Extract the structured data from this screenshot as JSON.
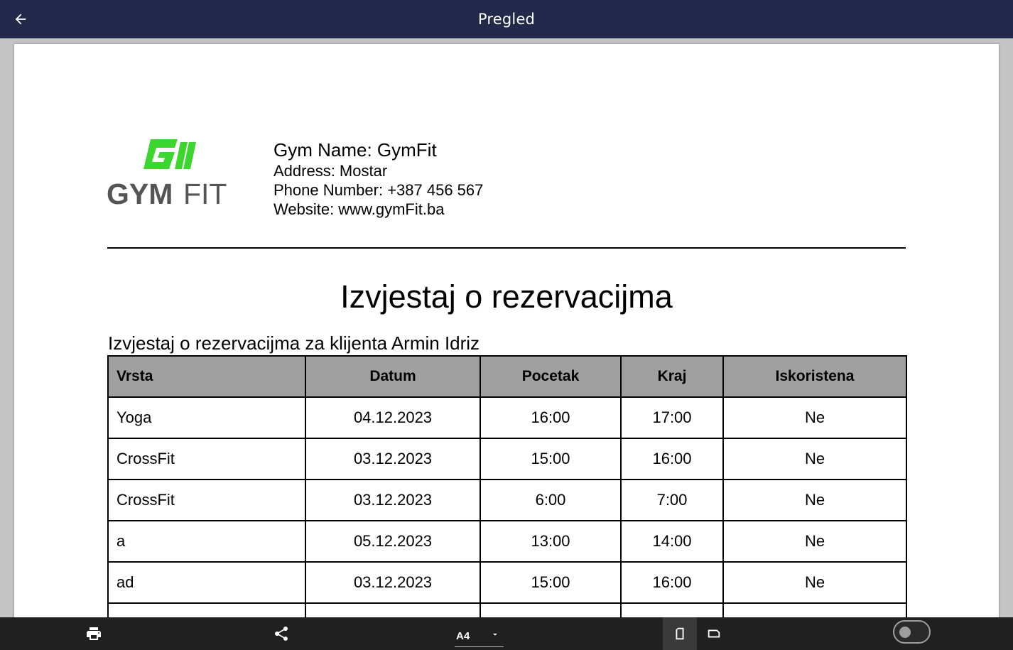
{
  "app_bar": {
    "title": "Pregled",
    "back_icon": "arrow-left-icon"
  },
  "document": {
    "logo": {
      "brand_text_bold": "GYM",
      "brand_text_light": "FIT",
      "monogram": "GI",
      "accent_color": "#3cd62e",
      "text_color": "#555555"
    },
    "gym_info": {
      "name": "Gym Name: GymFit",
      "address": "Address: Mostar",
      "phone": "Phone Number: +387 456 567",
      "website": "Website: www.gymFit.ba"
    },
    "report_title": "Izvjestaj o rezervacijma",
    "report_subtitle": "Izvjestaj o rezervacijma za klijenta Armin Idriz",
    "table": {
      "header_bg": "#a0a0a0",
      "columns": [
        "Vrsta",
        "Datum",
        "Pocetak",
        "Kraj",
        "Iskoristena"
      ],
      "rows": [
        [
          "Yoga",
          "04.12.2023",
          "16:00",
          "17:00",
          "Ne"
        ],
        [
          "CrossFit",
          "03.12.2023",
          "15:00",
          "16:00",
          "Ne"
        ],
        [
          "CrossFit",
          "03.12.2023",
          "6:00",
          "7:00",
          "Ne"
        ],
        [
          "a",
          "05.12.2023",
          "13:00",
          "14:00",
          "Ne"
        ],
        [
          "ad",
          "03.12.2023",
          "15:00",
          "16:00",
          "Ne"
        ],
        [
          "",
          "",
          "",
          "",
          ""
        ]
      ]
    }
  },
  "bottom_bar": {
    "print_icon": "print-icon",
    "share_icon": "share-icon",
    "paper_size": "A4",
    "dropdown_icon": "caret-down-icon",
    "portrait_icon": "portrait-orientation-icon",
    "landscape_icon": "landscape-orientation-icon",
    "toggle_state": "off"
  },
  "colors": {
    "app_bar_bg": "#22294a",
    "bottom_bar_bg": "#202020",
    "viewer_bg": "#c4c4c4"
  }
}
